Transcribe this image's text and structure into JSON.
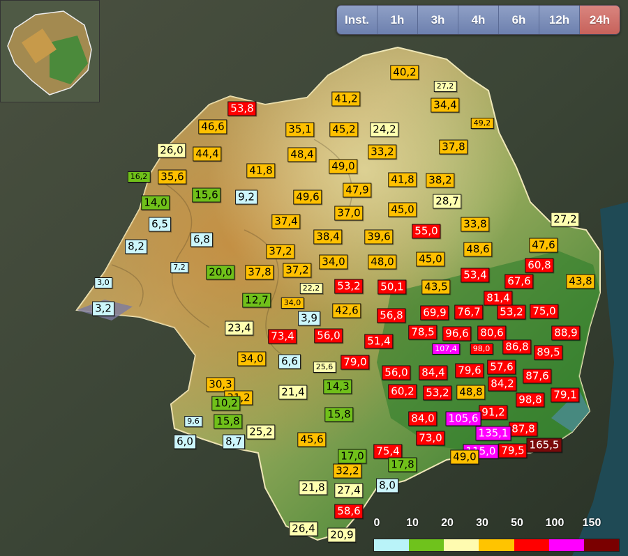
{
  "tabs": [
    {
      "label": "Inst.",
      "active": false
    },
    {
      "label": "1h",
      "active": false
    },
    {
      "label": "3h",
      "active": false
    },
    {
      "label": "4h",
      "active": false
    },
    {
      "label": "6h",
      "active": false
    },
    {
      "label": "12h",
      "active": false
    },
    {
      "label": "24h",
      "active": true
    }
  ],
  "legend": {
    "ticks": [
      "0",
      "10",
      "20",
      "30",
      "50",
      "100",
      "150"
    ],
    "colors": [
      "#b9f3f9",
      "#6fc21c",
      "#fffbb0",
      "#ffc400",
      "#ff0000",
      "#ff00ff",
      "#7a0000"
    ]
  },
  "class_colors": {
    "cyan": "#ccf6fb",
    "green": "#70c01a",
    "yellow": "#ffffb0",
    "orange": "#ffc000",
    "red": "#ff0000",
    "magenta": "#ff00ff",
    "darkred": "#7a0a0a"
  },
  "stations": [
    {
      "text": "40,2",
      "cls": "orange"
    },
    {
      "text": "27,2",
      "cls": "yellow",
      "small": true
    },
    {
      "text": "41,2",
      "cls": "orange"
    },
    {
      "text": "34,4",
      "cls": "orange"
    },
    {
      "text": "53,8",
      "cls": "red"
    },
    {
      "text": "46,6",
      "cls": "orange"
    },
    {
      "text": "35,1",
      "cls": "orange"
    },
    {
      "text": "45,2",
      "cls": "orange"
    },
    {
      "text": "24,2",
      "cls": "yellow"
    },
    {
      "text": "49,2",
      "cls": "orange",
      "small": true
    },
    {
      "text": "26,0",
      "cls": "yellow"
    },
    {
      "text": "44,4",
      "cls": "orange"
    },
    {
      "text": "48,4",
      "cls": "orange"
    },
    {
      "text": "33,2",
      "cls": "orange"
    },
    {
      "text": "37,8",
      "cls": "orange"
    },
    {
      "text": "49,0",
      "cls": "orange"
    },
    {
      "text": "41,8",
      "cls": "orange"
    },
    {
      "text": "16,2",
      "cls": "green",
      "small": true
    },
    {
      "text": "35,6",
      "cls": "orange"
    },
    {
      "text": "41,8",
      "cls": "orange"
    },
    {
      "text": "38,2",
      "cls": "orange"
    },
    {
      "text": "47,9",
      "cls": "orange"
    },
    {
      "text": "15,6",
      "cls": "green"
    },
    {
      "text": "9,2",
      "cls": "cyan"
    },
    {
      "text": "49,6",
      "cls": "orange"
    },
    {
      "text": "14,0",
      "cls": "green"
    },
    {
      "text": "28,7",
      "cls": "yellow"
    },
    {
      "text": "45,0",
      "cls": "orange"
    },
    {
      "text": "37,0",
      "cls": "orange"
    },
    {
      "text": "6,5",
      "cls": "cyan"
    },
    {
      "text": "37,4",
      "cls": "orange"
    },
    {
      "text": "27,2",
      "cls": "yellow"
    },
    {
      "text": "33,8",
      "cls": "orange"
    },
    {
      "text": "55,0",
      "cls": "red"
    },
    {
      "text": "38,4",
      "cls": "orange"
    },
    {
      "text": "39,6",
      "cls": "orange"
    },
    {
      "text": "6,8",
      "cls": "cyan"
    },
    {
      "text": "8,2",
      "cls": "cyan"
    },
    {
      "text": "47,6",
      "cls": "orange"
    },
    {
      "text": "48,6",
      "cls": "orange"
    },
    {
      "text": "37,2",
      "cls": "orange"
    },
    {
      "text": "45,0",
      "cls": "orange"
    },
    {
      "text": "34,0",
      "cls": "orange"
    },
    {
      "text": "48,0",
      "cls": "orange"
    },
    {
      "text": "60,8",
      "cls": "red"
    },
    {
      "text": "7,2",
      "cls": "cyan",
      "small": true
    },
    {
      "text": "20,0",
      "cls": "green"
    },
    {
      "text": "37,8",
      "cls": "orange"
    },
    {
      "text": "37,2",
      "cls": "orange"
    },
    {
      "text": "53,4",
      "cls": "red"
    },
    {
      "text": "3,0",
      "cls": "cyan",
      "small": true
    },
    {
      "text": "22,2",
      "cls": "yellow",
      "small": true
    },
    {
      "text": "53,2",
      "cls": "red"
    },
    {
      "text": "50,1",
      "cls": "red"
    },
    {
      "text": "43,5",
      "cls": "orange"
    },
    {
      "text": "67,6",
      "cls": "red"
    },
    {
      "text": "43,8",
      "cls": "orange"
    },
    {
      "text": "12,7",
      "cls": "green"
    },
    {
      "text": "34,0",
      "cls": "orange",
      "small": true
    },
    {
      "text": "81,4",
      "cls": "red"
    },
    {
      "text": "3,2",
      "cls": "cyan"
    },
    {
      "text": "42,6",
      "cls": "orange"
    },
    {
      "text": "56,8",
      "cls": "red"
    },
    {
      "text": "69,9",
      "cls": "red"
    },
    {
      "text": "76,7",
      "cls": "red"
    },
    {
      "text": "53,2",
      "cls": "red"
    },
    {
      "text": "75,0",
      "cls": "red"
    },
    {
      "text": "3,9",
      "cls": "cyan"
    },
    {
      "text": "23,4",
      "cls": "yellow"
    },
    {
      "text": "73,4",
      "cls": "red"
    },
    {
      "text": "56,0",
      "cls": "red"
    },
    {
      "text": "78,5",
      "cls": "red"
    },
    {
      "text": "96,6",
      "cls": "red"
    },
    {
      "text": "80,6",
      "cls": "red"
    },
    {
      "text": "88,9",
      "cls": "red"
    },
    {
      "text": "51,4",
      "cls": "red"
    },
    {
      "text": "107,4",
      "cls": "magenta",
      "small": true
    },
    {
      "text": "98,0",
      "cls": "red",
      "small": true
    },
    {
      "text": "86,8",
      "cls": "red"
    },
    {
      "text": "89,5",
      "cls": "red"
    },
    {
      "text": "34,0",
      "cls": "orange"
    },
    {
      "text": "6,6",
      "cls": "cyan"
    },
    {
      "text": "25,6",
      "cls": "yellow",
      "small": true
    },
    {
      "text": "79,0",
      "cls": "red"
    },
    {
      "text": "57,6",
      "cls": "red"
    },
    {
      "text": "56,0",
      "cls": "red"
    },
    {
      "text": "84,4",
      "cls": "red"
    },
    {
      "text": "79,6",
      "cls": "red"
    },
    {
      "text": "87,6",
      "cls": "red"
    },
    {
      "text": "30,3",
      "cls": "orange"
    },
    {
      "text": "14,3",
      "cls": "green"
    },
    {
      "text": "84,2",
      "cls": "red"
    },
    {
      "text": "21,4",
      "cls": "yellow"
    },
    {
      "text": "60,2",
      "cls": "red"
    },
    {
      "text": "53,2",
      "cls": "red"
    },
    {
      "text": "48,8",
      "cls": "orange"
    },
    {
      "text": "79,1",
      "cls": "red"
    },
    {
      "text": "31,2",
      "cls": "orange"
    },
    {
      "text": "98,8",
      "cls": "red"
    },
    {
      "text": "10,2",
      "cls": "green"
    },
    {
      "text": "91,2",
      "cls": "red"
    },
    {
      "text": "15,8",
      "cls": "green"
    },
    {
      "text": "84,0",
      "cls": "red"
    },
    {
      "text": "105,6",
      "cls": "magenta"
    },
    {
      "text": "9,6",
      "cls": "cyan",
      "small": true
    },
    {
      "text": "15,8",
      "cls": "green"
    },
    {
      "text": "87,8",
      "cls": "red"
    },
    {
      "text": "25,2",
      "cls": "yellow"
    },
    {
      "text": "135,1",
      "cls": "magenta"
    },
    {
      "text": "6,0",
      "cls": "cyan"
    },
    {
      "text": "8,7",
      "cls": "cyan"
    },
    {
      "text": "73,0",
      "cls": "red"
    },
    {
      "text": "45,6",
      "cls": "orange"
    },
    {
      "text": "165,5",
      "cls": "darkred"
    },
    {
      "text": "75,4",
      "cls": "red"
    },
    {
      "text": "115,0",
      "cls": "magenta"
    },
    {
      "text": "79,5",
      "cls": "red"
    },
    {
      "text": "17,0",
      "cls": "green"
    },
    {
      "text": "49,0",
      "cls": "orange"
    },
    {
      "text": "17,8",
      "cls": "green"
    },
    {
      "text": "32,2",
      "cls": "orange"
    },
    {
      "text": "8,0",
      "cls": "cyan"
    },
    {
      "text": "21,8",
      "cls": "yellow"
    },
    {
      "text": "27,4",
      "cls": "yellow"
    },
    {
      "text": "58,6",
      "cls": "red"
    },
    {
      "text": "26,4",
      "cls": "yellow"
    },
    {
      "text": "20,9",
      "cls": "yellow"
    }
  ]
}
